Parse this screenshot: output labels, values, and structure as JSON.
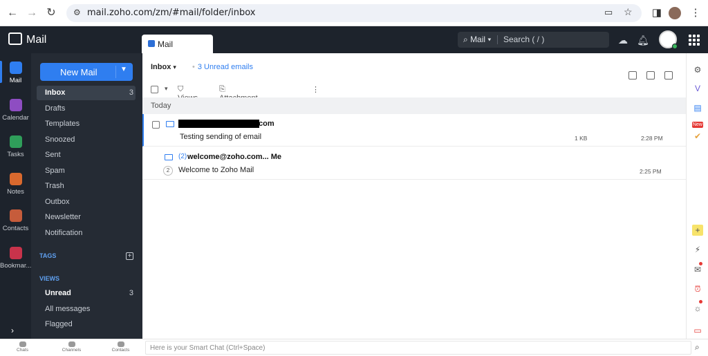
{
  "browser": {
    "url": "mail.zoho.com/zm/#mail/folder/inbox"
  },
  "topbar": {
    "brand": "Mail",
    "tab_label": "Mail",
    "search_scope": "Mail",
    "search_placeholder": "Search ( / )"
  },
  "appbar": {
    "items": [
      {
        "label": "Mail",
        "icon": "mail-icon",
        "color": "#2f7ef0"
      },
      {
        "label": "Calendar",
        "icon": "calendar-icon",
        "color": "#8e4dc2"
      },
      {
        "label": "Tasks",
        "icon": "tasks-icon",
        "color": "#2f9e5a"
      },
      {
        "label": "Notes",
        "icon": "notes-icon",
        "color": "#d9692e"
      },
      {
        "label": "Contacts",
        "icon": "contacts-icon",
        "color": "#c65c3b"
      },
      {
        "label": "Bookmar...",
        "icon": "bookmark-icon",
        "color": "#c8334b"
      }
    ],
    "expand": "›"
  },
  "folders": {
    "new_mail": "New Mail",
    "items": [
      {
        "label": "Inbox",
        "count": "3"
      },
      {
        "label": "Drafts",
        "count": ""
      },
      {
        "label": "Templates",
        "count": ""
      },
      {
        "label": "Snoozed",
        "count": ""
      },
      {
        "label": "Sent",
        "count": ""
      },
      {
        "label": "Spam",
        "count": ""
      },
      {
        "label": "Trash",
        "count": ""
      },
      {
        "label": "Outbox",
        "count": ""
      },
      {
        "label": "Newsletter",
        "count": ""
      },
      {
        "label": "Notification",
        "count": ""
      }
    ],
    "tags_heading": "TAGS",
    "views_heading": "VIEWS",
    "views": [
      {
        "label": "Unread",
        "count": "3"
      },
      {
        "label": "All messages",
        "count": ""
      },
      {
        "label": "Flagged",
        "count": ""
      }
    ]
  },
  "main": {
    "folder": "Inbox",
    "unread_link": "3 Unread emails",
    "views_label": "Views",
    "attachment_label": "Attachment options",
    "group_today": "Today",
    "emails": [
      {
        "sender_suffix": "com",
        "subject": "Testing sending of email",
        "size": "1 KB",
        "time": "2:28 PM"
      },
      {
        "thread": "(2)",
        "sender": "welcome@zoho.com... Me",
        "count": "2",
        "subject": "Welcome to Zoho Mail",
        "time": "2:25 PM"
      }
    ]
  },
  "rightbar": {
    "new_badge": "New"
  },
  "bottom": {
    "tabs": [
      "Chats",
      "Channels",
      "Contacts"
    ],
    "smart_chat_placeholder": "Here is your Smart Chat (Ctrl+Space)"
  }
}
